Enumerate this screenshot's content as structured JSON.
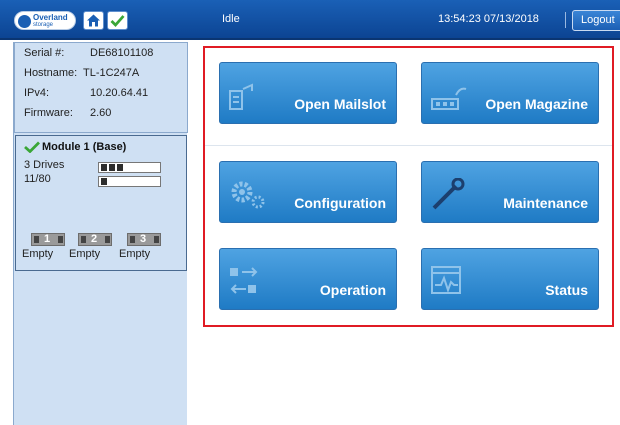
{
  "header": {
    "logo_text": "Overland",
    "logo_subtext": "storage",
    "status": "Idle",
    "datetime": "13:54:23 07/13/2018",
    "logout_label": "Logout",
    "icons": [
      "overland-logo-icon",
      "home-icon",
      "checkmark-icon"
    ]
  },
  "system_info": {
    "serial_label": "Serial #:",
    "serial_value": "DE68101108",
    "hostname_label": "Hostname:",
    "hostname_value": "TL-1C247A",
    "ipv4_label": "IPv4:",
    "ipv4_value": "10.20.64.41",
    "firmware_label": "Firmware:",
    "firmware_value": "2.60"
  },
  "module": {
    "title": "Module 1 (Base)",
    "status_icon": "checkmark-icon",
    "drives_label": "3 Drives",
    "drives_filled": 3,
    "slots_label": "11/80",
    "slots_filled": 1,
    "magazines": [
      {
        "number": "1",
        "status": "Empty"
      },
      {
        "number": "2",
        "status": "Empty"
      },
      {
        "number": "3",
        "status": "Empty"
      }
    ]
  },
  "actions": [
    {
      "label": "Open Mailslot",
      "icon": "mailslot-icon"
    },
    {
      "label": "Open Magazine",
      "icon": "magazine-icon"
    },
    {
      "label": "Configuration",
      "icon": "gears-icon"
    },
    {
      "label": "Maintenance",
      "icon": "wrench-icon"
    },
    {
      "label": "Operation",
      "icon": "operation-arrows-icon"
    },
    {
      "label": "Status",
      "icon": "status-chart-icon"
    }
  ],
  "colors": {
    "header_blue": "#1a60b6",
    "sidebar_bg": "#cfe0f3",
    "tile_blue": "#1f7bc5",
    "highlight_red": "#e01b24",
    "check_green": "#3aa637"
  }
}
